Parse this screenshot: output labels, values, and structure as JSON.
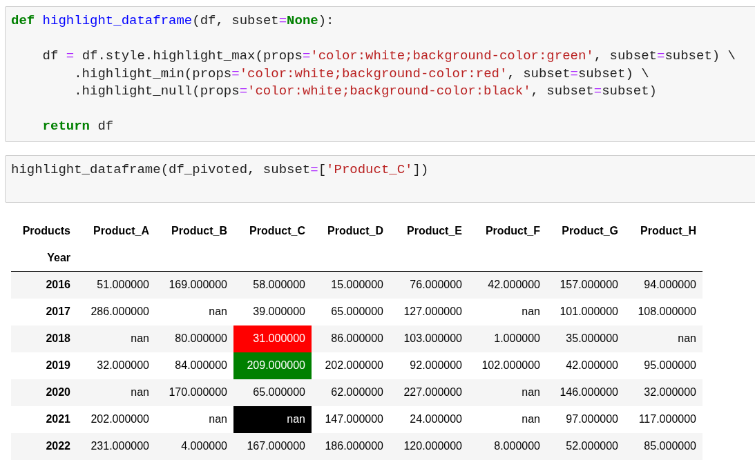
{
  "cells": [
    {
      "kind": "code",
      "blocks": [
        [
          [
            {
              "kind": "keyword",
              "text": "def"
            },
            {
              "kind": "function",
              "text": " highlight_dataframe"
            },
            {
              "kind": "plain",
              "text": "(df, subset"
            },
            {
              "kind": "operator",
              "text": "="
            },
            {
              "kind": "keyword",
              "text": "None"
            },
            {
              "kind": "plain",
              "text": "):"
            }
          ]
        ],
        [
          [
            {
              "kind": "plain",
              "text": "    df "
            },
            {
              "kind": "operator",
              "text": "="
            },
            {
              "kind": "plain",
              "text": " df.style.highlight_max(props"
            },
            {
              "kind": "operator",
              "text": "="
            },
            {
              "kind": "string",
              "text": "'color:white;background-color:green'"
            },
            {
              "kind": "plain",
              "text": ", subset"
            },
            {
              "kind": "operator",
              "text": "="
            },
            {
              "kind": "plain",
              "text": "subset) \\"
            }
          ],
          [
            {
              "kind": "plain",
              "text": "        .highlight_min(props"
            },
            {
              "kind": "operator",
              "text": "="
            },
            {
              "kind": "string",
              "text": "'color:white;background-color:red'"
            },
            {
              "kind": "plain",
              "text": ", subset"
            },
            {
              "kind": "operator",
              "text": "="
            },
            {
              "kind": "plain",
              "text": "subset) \\"
            }
          ],
          [
            {
              "kind": "plain",
              "text": "        .highlight_null(props"
            },
            {
              "kind": "operator",
              "text": "="
            },
            {
              "kind": "string",
              "text": "'color:white;background-color:black'"
            },
            {
              "kind": "plain",
              "text": ", subset"
            },
            {
              "kind": "operator",
              "text": "="
            },
            {
              "kind": "plain",
              "text": "subset)"
            }
          ]
        ],
        [
          [
            {
              "kind": "keyword",
              "text": "    return"
            },
            {
              "kind": "plain",
              "text": " df"
            }
          ]
        ]
      ]
    },
    {
      "kind": "code",
      "blocks": [
        [
          [
            {
              "kind": "plain",
              "text": "highlight_dataframe(df_pivoted, subset"
            },
            {
              "kind": "operator",
              "text": "="
            },
            {
              "kind": "plain",
              "text": "["
            },
            {
              "kind": "string",
              "text": "'Product_C'"
            },
            {
              "kind": "plain",
              "text": "])"
            }
          ]
        ]
      ]
    }
  ],
  "table": {
    "columns_name": "Products",
    "index_name": "Year",
    "columns": [
      "Product_A",
      "Product_B",
      "Product_C",
      "Product_D",
      "Product_E",
      "Product_F",
      "Product_G",
      "Product_H"
    ],
    "rows": [
      {
        "year": "2016",
        "cells": [
          "51.000000",
          "169.000000",
          "58.000000",
          "15.000000",
          "76.000000",
          "42.000000",
          "157.000000",
          "94.000000"
        ]
      },
      {
        "year": "2017",
        "cells": [
          "286.000000",
          "nan",
          "39.000000",
          "65.000000",
          "127.000000",
          "nan",
          "101.000000",
          "108.000000"
        ]
      },
      {
        "year": "2018",
        "cells": [
          "nan",
          "80.000000",
          {
            "text": "31.000000",
            "color": "#ff0000"
          },
          "86.000000",
          "103.000000",
          "1.000000",
          "35.000000",
          "nan"
        ]
      },
      {
        "year": "2019",
        "cells": [
          "32.000000",
          "84.000000",
          {
            "text": "209.000000",
            "color": "#008000"
          },
          "202.000000",
          "92.000000",
          "102.000000",
          "42.000000",
          "95.000000"
        ]
      },
      {
        "year": "2020",
        "cells": [
          "nan",
          "170.000000",
          "65.000000",
          "62.000000",
          "227.000000",
          "nan",
          "146.000000",
          "32.000000"
        ]
      },
      {
        "year": "2021",
        "cells": [
          "202.000000",
          "nan",
          {
            "text": "nan",
            "color": "#000000"
          },
          "147.000000",
          "24.000000",
          "nan",
          "97.000000",
          "117.000000"
        ]
      },
      {
        "year": "2022",
        "cells": [
          "231.000000",
          "4.000000",
          "167.000000",
          "186.000000",
          "120.000000",
          "8.000000",
          "52.000000",
          "85.000000"
        ]
      }
    ]
  }
}
